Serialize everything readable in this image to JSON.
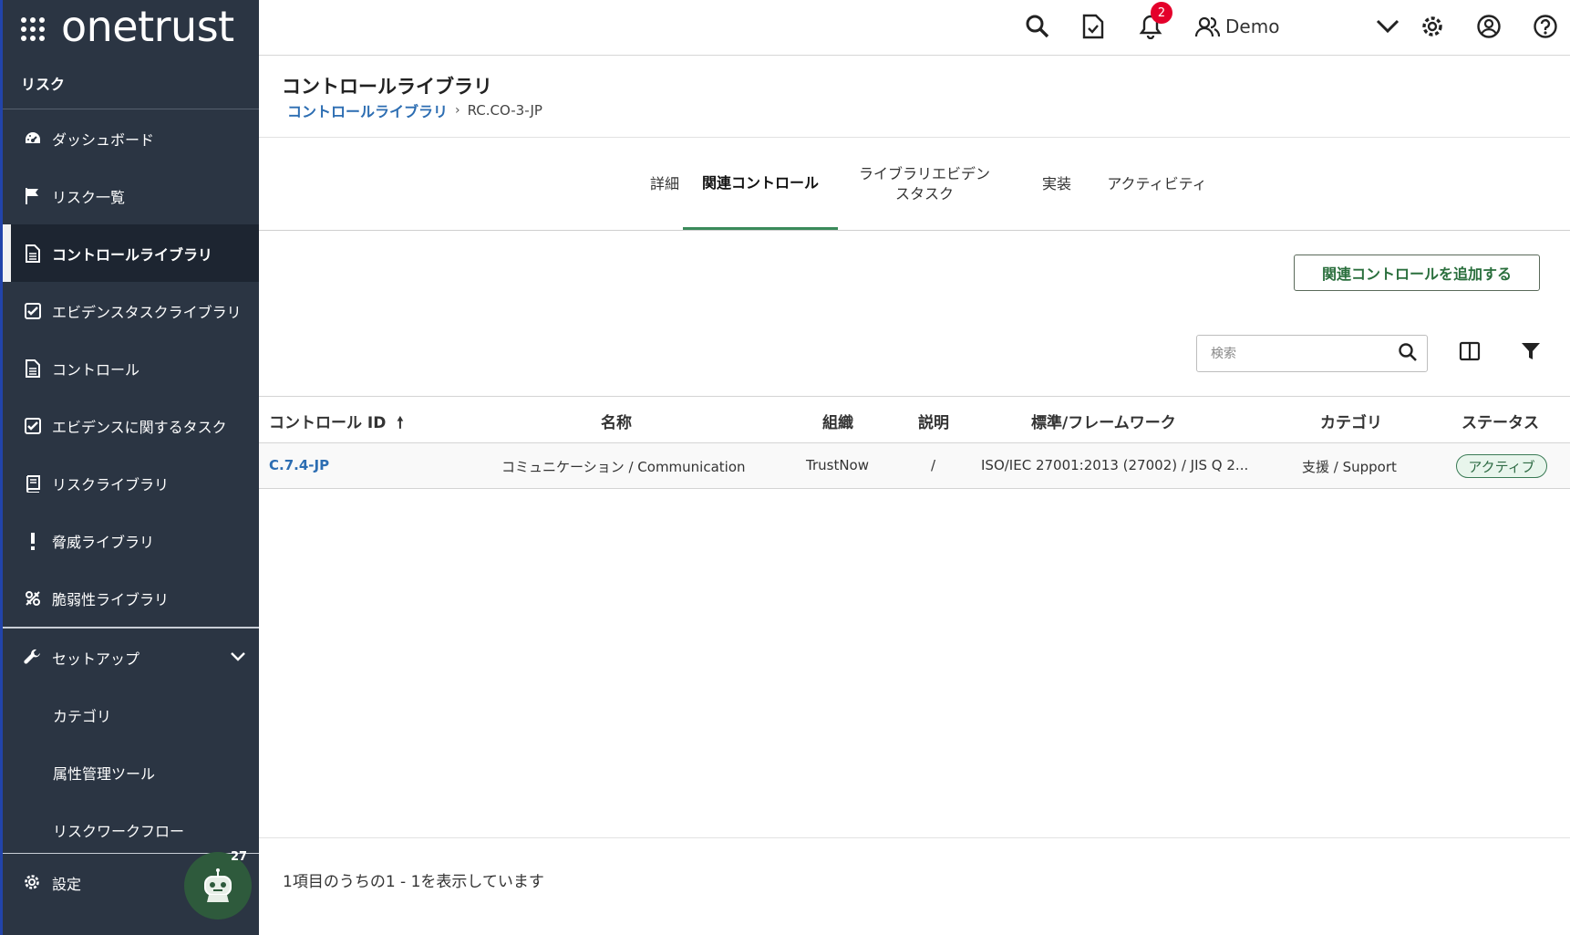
{
  "app": {
    "brand": "onetrust",
    "module": "リスク"
  },
  "sidebar": {
    "items": [
      {
        "label": "ダッシュボード",
        "icon": "dashboard-icon"
      },
      {
        "label": "リスク一覧",
        "icon": "flag-icon"
      },
      {
        "label": "コントロールライブラリ",
        "icon": "document-icon"
      },
      {
        "label": "エビデンスタスクライブラリ",
        "icon": "checkbox-icon"
      },
      {
        "label": "コントロール",
        "icon": "document-icon"
      },
      {
        "label": "エビデンスに関するタスク",
        "icon": "checkbox-icon"
      },
      {
        "label": "リスクライブラリ",
        "icon": "book-icon"
      },
      {
        "label": "脅威ライブラリ",
        "icon": "exclamation-icon"
      },
      {
        "label": "脆弱性ライブラリ",
        "icon": "vulnerability-icon"
      }
    ],
    "setup": {
      "label": "セットアップ",
      "children": [
        "カテゴリ",
        "属性管理ツール",
        "リスクワークフロー"
      ]
    },
    "settings_label": "設定",
    "bot_count": "27"
  },
  "topbar": {
    "notification_count": "2",
    "user": "Demo"
  },
  "page": {
    "title": "コントロールライブラリ",
    "breadcrumb_link": "コントロールライブラリ",
    "breadcrumb_current": "RC.CO-3-JP"
  },
  "tabs": {
    "details": "詳細",
    "related": "関連コントロール",
    "evidence_line1": "ライブラリエビデン",
    "evidence_line2": "スタスク",
    "implementation": "実装",
    "activity": "アクティビティ"
  },
  "actions": {
    "add_label": "関連コントロールを追加する",
    "search_placeholder": "検索"
  },
  "table": {
    "headers": {
      "id": "コントロール ID",
      "name": "名称",
      "org": "組織",
      "desc": "説明",
      "standard": "標準/フレームワーク",
      "category": "カテゴリ",
      "status": "ステータス"
    },
    "rows": [
      {
        "id": "C.7.4-JP",
        "name": "コミュニケーション / Communication",
        "org": "TrustNow",
        "desc": "/",
        "standard": "ISO/IEC 27001:2013 (27002) / JIS Q 2...",
        "category": "支援 / Support",
        "status": "アクティブ"
      }
    ]
  },
  "footer": {
    "count_text": "1項目のうちの1 - 1を表示しています"
  },
  "colors": {
    "sidebar_bg": "#2b3543",
    "link": "#2c6db2",
    "accent_green": "#3a8a5a",
    "badge_red": "#e4002b"
  }
}
